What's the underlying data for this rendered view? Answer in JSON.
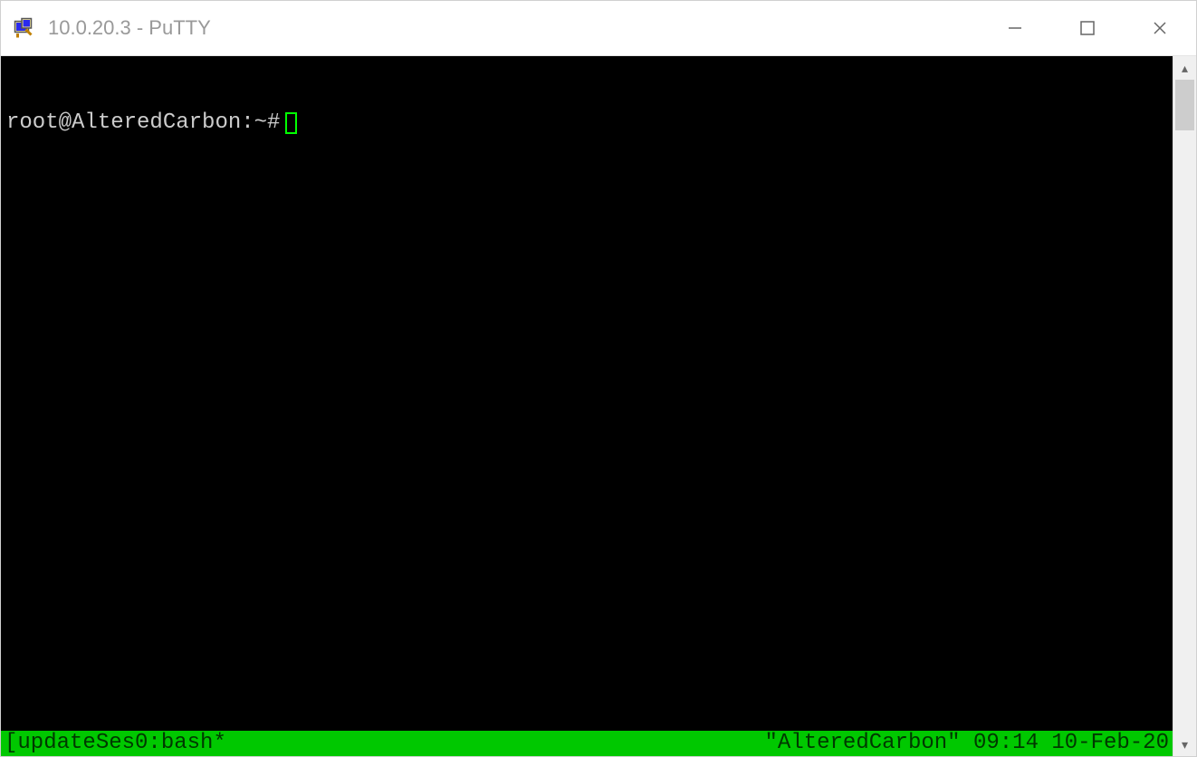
{
  "window": {
    "title": "10.0.20.3 - PuTTY"
  },
  "terminal": {
    "prompt": "root@AlteredCarbon:~#"
  },
  "statusbar": {
    "left": "[updateSes0:bash*",
    "right": "\"AlteredCarbon\" 09:14 10-Feb-20"
  },
  "scrollbar": {
    "up_glyph": "▴",
    "down_glyph": "▾"
  }
}
